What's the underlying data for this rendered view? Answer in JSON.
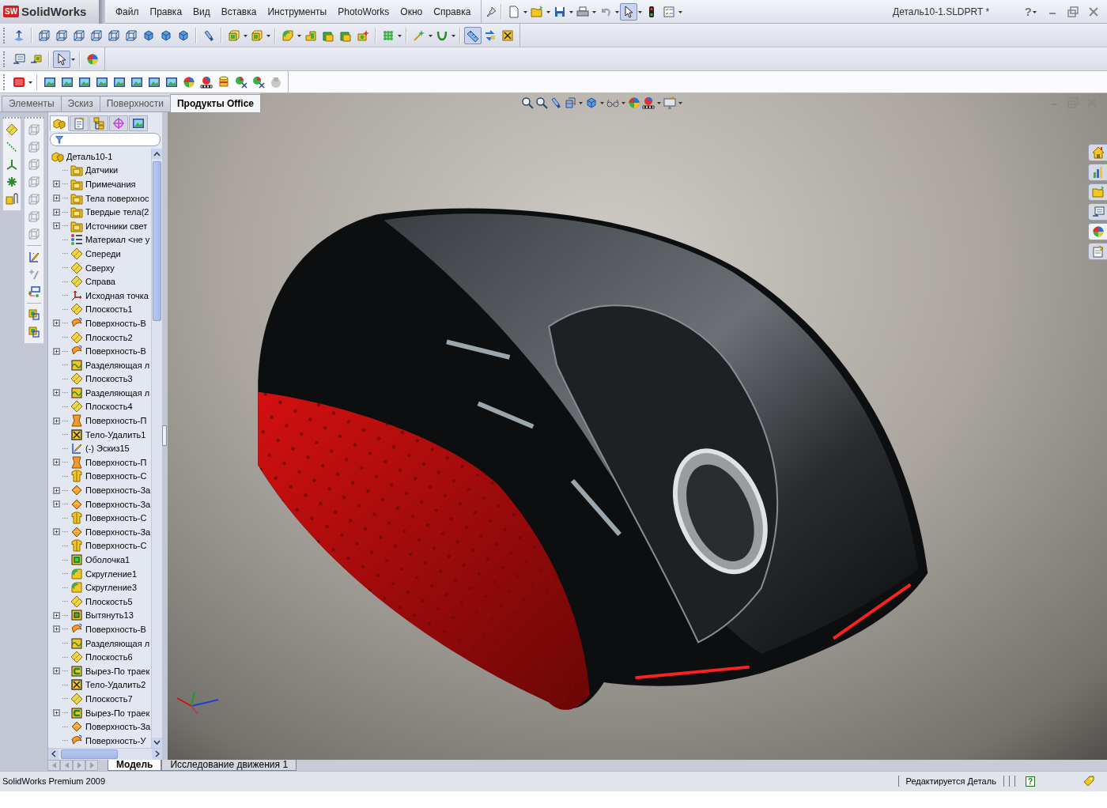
{
  "app": {
    "logo_badge": "SW",
    "logo_name": "SolidWorks"
  },
  "menu": [
    "Файл",
    "Правка",
    "Вид",
    "Вставка",
    "Инструменты",
    "PhotoWorks",
    "Окно",
    "Справка"
  ],
  "window": {
    "title": "Деталь10-1.SLDPRT *",
    "help": "?"
  },
  "command_tabs": [
    {
      "label": "Элементы",
      "selected": false
    },
    {
      "label": "Эскиз",
      "selected": false
    },
    {
      "label": "Поверхности",
      "selected": false
    },
    {
      "label": "Продукты Office",
      "selected": true
    }
  ],
  "panel_tabs": [
    {
      "selected": true
    },
    {
      "selected": false
    },
    {
      "selected": false
    },
    {
      "selected": false
    },
    {
      "selected": false
    }
  ],
  "feature_tree": {
    "root": {
      "label": "Деталь10-1",
      "kind": "part",
      "children": [
        {
          "label": "Датчики",
          "kind": "folder",
          "expandable": false
        },
        {
          "label": "Примечания",
          "kind": "folder",
          "expandable": true
        },
        {
          "label": "Тела поверхнос",
          "kind": "folder",
          "expandable": true
        },
        {
          "label": "Твердые тела(2",
          "kind": "folder",
          "expandable": true
        },
        {
          "label": "Источники свет",
          "kind": "folder",
          "expandable": true
        },
        {
          "label": "Материал <не у",
          "kind": "material",
          "expandable": false
        },
        {
          "label": "Спереди",
          "kind": "plane",
          "expandable": false
        },
        {
          "label": "Сверху",
          "kind": "plane",
          "expandable": false
        },
        {
          "label": "Справа",
          "kind": "plane",
          "expandable": false
        },
        {
          "label": "Исходная точка",
          "kind": "origin",
          "expandable": false
        },
        {
          "label": "Плоскость1",
          "kind": "plane",
          "expandable": false
        },
        {
          "label": "Поверхность-В",
          "kind": "surface",
          "expandable": true
        },
        {
          "label": "Плоскость2",
          "kind": "plane",
          "expandable": false
        },
        {
          "label": "Поверхность-В",
          "kind": "surface",
          "expandable": true
        },
        {
          "label": "Разделяющая л",
          "kind": "split",
          "expandable": false
        },
        {
          "label": "Плоскость3",
          "kind": "plane",
          "expandable": false
        },
        {
          "label": "Разделяющая л",
          "kind": "split",
          "expandable": true
        },
        {
          "label": "Плоскость4",
          "kind": "plane",
          "expandable": false
        },
        {
          "label": "Поверхность-П",
          "kind": "loft",
          "expandable": true
        },
        {
          "label": "Тело-Удалить1",
          "kind": "delete",
          "expandable": false
        },
        {
          "label": "(-) Эскиз15",
          "kind": "sketch",
          "expandable": false
        },
        {
          "label": "Поверхность-П",
          "kind": "loft",
          "expandable": true
        },
        {
          "label": "Поверхность-С",
          "kind": "knit",
          "expandable": false
        },
        {
          "label": "Поверхность-За",
          "kind": "fill",
          "expandable": true
        },
        {
          "label": "Поверхность-За",
          "kind": "fill",
          "expandable": true
        },
        {
          "label": "Поверхность-С",
          "kind": "knit",
          "expandable": false
        },
        {
          "label": "Поверхность-За",
          "kind": "fill",
          "expandable": true
        },
        {
          "label": "Поверхность-С",
          "kind": "knit",
          "expandable": false
        },
        {
          "label": "Оболочка1",
          "kind": "shell",
          "expandable": false
        },
        {
          "label": "Скругление1",
          "kind": "fillet",
          "expandable": false
        },
        {
          "label": "Скругление3",
          "kind": "fillet",
          "expandable": false
        },
        {
          "label": "Плоскость5",
          "kind": "plane",
          "expandable": false
        },
        {
          "label": "Вытянуть13",
          "kind": "extrude",
          "expandable": true
        },
        {
          "label": "Поверхность-В",
          "kind": "surface",
          "expandable": true
        },
        {
          "label": "Разделяющая л",
          "kind": "split",
          "expandable": false
        },
        {
          "label": "Плоскость6",
          "kind": "plane",
          "expandable": false
        },
        {
          "label": "Вырез-По траек",
          "kind": "sweep",
          "expandable": true
        },
        {
          "label": "Тело-Удалить2",
          "kind": "delete",
          "expandable": false
        },
        {
          "label": "Плоскость7",
          "kind": "plane",
          "expandable": false
        },
        {
          "label": "Вырез-По траек",
          "kind": "sweep",
          "expandable": true
        },
        {
          "label": "Поверхность-За",
          "kind": "fill",
          "expandable": false
        },
        {
          "label": "Поверхность-У",
          "kind": "surface",
          "expandable": false
        }
      ]
    }
  },
  "task_pane_tabs": [
    {
      "selected": false
    },
    {
      "selected": false
    },
    {
      "selected": false
    },
    {
      "selected": false
    },
    {
      "selected": true
    },
    {
      "selected": false
    }
  ],
  "bottom_tabs": [
    {
      "label": "Модель",
      "selected": true
    },
    {
      "label": "Исследование движения 1",
      "selected": false
    }
  ],
  "status_bar": {
    "product": "SolidWorks Premium 2009",
    "mode": "Редактируется Деталь",
    "help": "?"
  }
}
